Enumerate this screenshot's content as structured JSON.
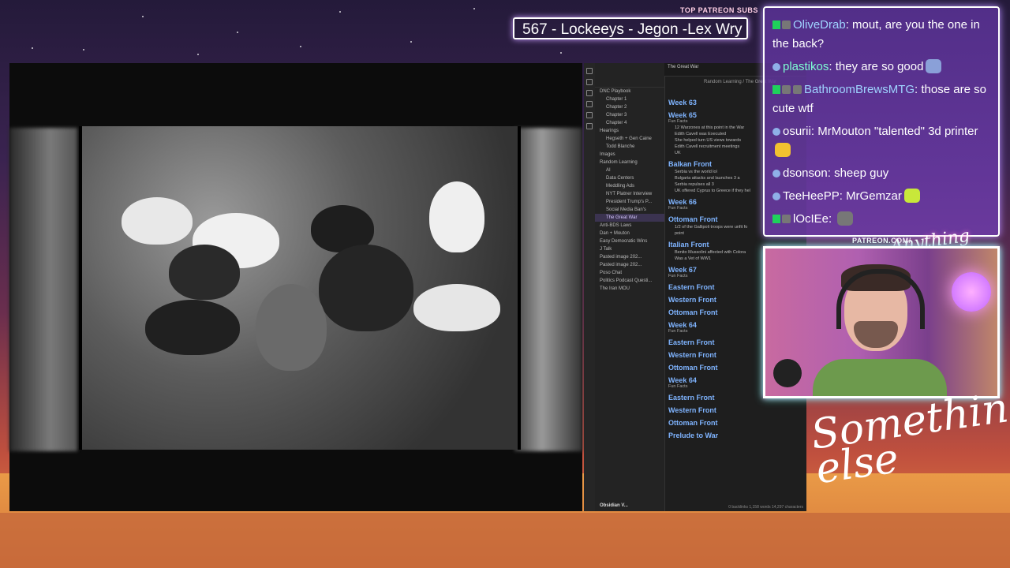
{
  "top_patreon": {
    "label": "TOP PATREON SUBS",
    "names": "567 - Lockeeys - Jegon -Lex Wry"
  },
  "obsidian": {
    "tab": "The Great War",
    "breadcrumb": "Random Learning  /  The Great War",
    "tree": [
      "DNC Playbook",
      "Chapter 1",
      "Chapter 2",
      "Chapter 3",
      "Chapter 4",
      "Hearings",
      "Hegseth + Gen Caine",
      "Todd Blanche",
      "Images",
      "Random Learning",
      "AI",
      "Data Centers",
      "Meddling Ads",
      "NYT Platner Interview",
      "President Trump's P...",
      "Social Media Ban's",
      "The Great War",
      "Anti-BDS Laws",
      "Dan + Mouton",
      "Easy Democratic Wins",
      "J Talk",
      "Pasted image 202...",
      "Pasted image 202...",
      "Poso Chat",
      "Politics Podcast Questi...",
      "The Iran MOU"
    ],
    "vault": "Obsidian V...",
    "doc": [
      {
        "h": "Week 63",
        "sub": "",
        "items": []
      },
      {
        "h": "Week 65",
        "sub": "Fun Facts",
        "items": [
          "12 Warzones at this point in the War",
          "Edith Cavell was Executed",
          "She helped turn US views towards",
          "Edith Cavell recruitment meetings",
          "UK"
        ]
      },
      {
        "h": "Balkan Front",
        "sub": "",
        "items": [
          "Serbia vs the world lol",
          "Bulgaria attacks and launches 3 a",
          "Serbia repulses all 3",
          "UK offered Cyprus to Greece if they hel"
        ]
      },
      {
        "h": "Week 66",
        "sub": "Fun Facts",
        "items": []
      },
      {
        "h": "Ottoman Front",
        "sub": "",
        "items": [
          "1/2 of the Gallipoli troops were unfit fo",
          "point"
        ]
      },
      {
        "h": "Italian Front",
        "sub": "",
        "items": [
          "Benito Mussolini affected with Colora",
          "Was a Vet of WW1"
        ]
      },
      {
        "h": "Week 67",
        "sub": "Fun Facts",
        "items": []
      },
      {
        "h": "Eastern Front",
        "sub": "",
        "items": []
      },
      {
        "h": "Western Front",
        "sub": "",
        "items": []
      },
      {
        "h": "Ottoman Front",
        "sub": "",
        "items": []
      },
      {
        "h": "Week 64",
        "sub": "Fun Facts",
        "items": []
      },
      {
        "h": "Eastern Front",
        "sub": "",
        "items": []
      },
      {
        "h": "Western Front",
        "sub": "",
        "items": []
      },
      {
        "h": "Ottoman Front",
        "sub": "",
        "items": []
      },
      {
        "h": "Week 64",
        "sub": "Fun Facts",
        "items": []
      },
      {
        "h": "Eastern Front",
        "sub": "",
        "items": []
      },
      {
        "h": "Western Front",
        "sub": "",
        "items": []
      },
      {
        "h": "Ottoman Front",
        "sub": "",
        "items": []
      },
      {
        "h": "Prelude to War",
        "sub": "",
        "items": []
      }
    ],
    "status": "0 backlinks   1,158 words  14,297 characters"
  },
  "chat": [
    {
      "user": "OliveDrab",
      "color": "#9fd3ff",
      "text": "mout, are you the one in the back?",
      "badges": "km"
    },
    {
      "user": "plastikos",
      "color": "#7fffd4",
      "text": "they are so good",
      "badges": "c",
      "emote": "#8aa0d8"
    },
    {
      "user": "BathroomBrewsMTG",
      "color": "#9fd3ff",
      "text": "those are so cute wtf",
      "badges": "kmm"
    },
    {
      "user": "osurii",
      "color": "#ffffff",
      "text": "MrMouton \"talented\" 3d printer",
      "badges": "c",
      "emote": "#f2c230"
    },
    {
      "user": "dsonson",
      "color": "#ffffff",
      "text": "sheep guy",
      "badges": "c"
    },
    {
      "user": "TeeHeePP",
      "color": "#ffffff",
      "text": "MrGemzar",
      "badges": "c",
      "emote": "#c8e83a"
    },
    {
      "user": "lOcIEe",
      "color": "#ffffff",
      "text": "",
      "badges": "km",
      "emote": "#777"
    }
  ],
  "webcam": {
    "patreon_label": "PATREON.COM/",
    "overlay_logo": "Anything else?"
  },
  "signature": "Something else"
}
